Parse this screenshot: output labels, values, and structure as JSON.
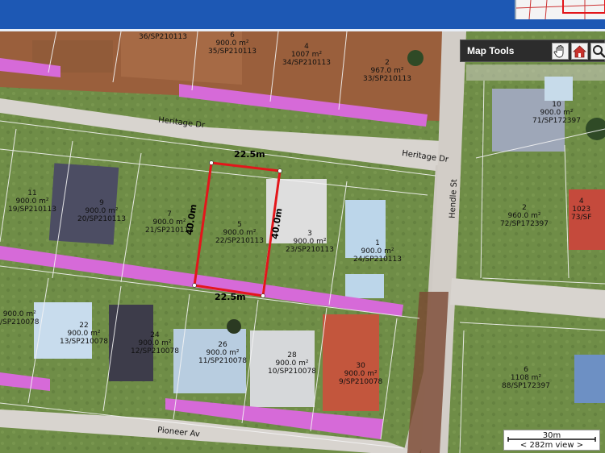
{
  "header": {
    "background": "#1d58b4"
  },
  "map_tools": {
    "title": "Map Tools",
    "tools": [
      "hand-pan-icon",
      "home-icon",
      "zoom-icon"
    ]
  },
  "selected_lot": {
    "number": "5",
    "area": "900.0 m²",
    "plan": "22/SP210113",
    "outline_color": "#e3161b",
    "frontage": "22.5m",
    "rear": "22.5m",
    "left_depth": "40.0m",
    "right_depth": "40.0m"
  },
  "streets": {
    "heritage_dr_1": "Heritage Dr",
    "heritage_dr_2": "Heritage Dr",
    "hendle_st": "Hendle St",
    "pioneer_av": "Pioneer Av"
  },
  "lots": [
    {
      "num": "",
      "area": "",
      "plan": "36/SP210113"
    },
    {
      "num": "6",
      "area": "900.0 m²",
      "plan": "35/SP210113"
    },
    {
      "num": "4",
      "area": "1007 m²",
      "plan": "34/SP210113"
    },
    {
      "num": "2",
      "area": "967.0 m²",
      "plan": "33/SP210113"
    },
    {
      "num": "10",
      "area": "900.0 m²",
      "plan": "71/SP172397"
    },
    {
      "num": "11",
      "area": "900.0 m²",
      "plan": "19/SP210113"
    },
    {
      "num": "9",
      "area": "900.0 m²",
      "plan": "20/SP210113"
    },
    {
      "num": "7",
      "area": "900.0 m²",
      "plan": "21/SP210113"
    },
    {
      "num": "3",
      "area": "900.0 m²",
      "plan": "23/SP210113"
    },
    {
      "num": "1",
      "area": "900.0 m²",
      "plan": "24/SP210113"
    },
    {
      "num": "2",
      "area": "960.0 m²",
      "plan": "72/SP172397"
    },
    {
      "num": "4",
      "area": "1023",
      "plan": "73/SF"
    },
    {
      "num": "",
      "area": "900.0 m²",
      "plan": "/SP210078"
    },
    {
      "num": "22",
      "area": "900.0 m²",
      "plan": "13/SP210078"
    },
    {
      "num": "24",
      "area": "900.0 m²",
      "plan": "12/SP210078"
    },
    {
      "num": "26",
      "area": "900.0 m²",
      "plan": "11/SP210078"
    },
    {
      "num": "28",
      "area": "900.0 m²",
      "plan": "10/SP210078"
    },
    {
      "num": "30",
      "area": "900.0 m²",
      "plan": "9/SP210078"
    },
    {
      "num": "6",
      "area": "1108 m²",
      "plan": "88/SP172397"
    }
  ],
  "scale": {
    "distance": "30m",
    "view": "< 282m view >"
  },
  "colors": {
    "easement": "#d66ad8",
    "lot_lines": "#f4f4f4",
    "road": "#d9d6d2"
  }
}
